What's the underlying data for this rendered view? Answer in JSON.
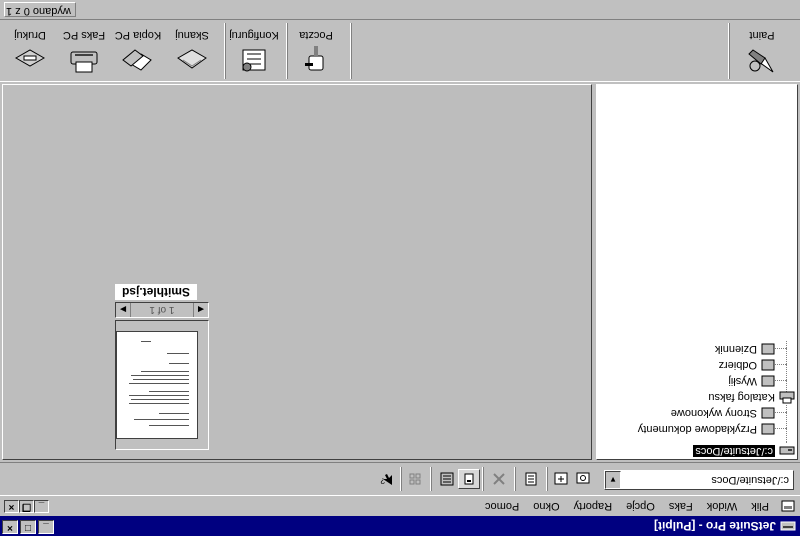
{
  "window": {
    "title": "JetSuite Pro - [Pulpit]",
    "controls": [
      "_",
      "□",
      "×"
    ]
  },
  "menu": {
    "items": [
      "Plik",
      "Widok",
      "Faks",
      "Opcje",
      "Raporty",
      "Okno",
      "Pomoc"
    ],
    "underline": [
      "P",
      "W",
      "F",
      "O",
      "R",
      "O",
      "P"
    ],
    "mdi_controls": [
      "_",
      "❐",
      "×"
    ]
  },
  "path_bar": {
    "value": "c:/Jetsuite/Docs",
    "arrow": "▼"
  },
  "tree": {
    "items": [
      {
        "label": "c:/Jetsuite/Docs",
        "level": 0,
        "selected": true,
        "icon": "drive-icon"
      },
      {
        "label": "Przykładowe dokumenty",
        "level": 1,
        "icon": "folder-icon"
      },
      {
        "label": "Strony wykonowe",
        "level": 1,
        "icon": "folder-icon"
      },
      {
        "label": "Katalog faksu",
        "level": 0,
        "icon": "fax-icon"
      },
      {
        "label": "Wysłij",
        "level": 1,
        "icon": "folder-icon"
      },
      {
        "label": "Odbierz",
        "level": 1,
        "icon": "folder-icon"
      },
      {
        "label": "Dziennik",
        "level": 1,
        "icon": "folder-icon"
      }
    ]
  },
  "thumbnail": {
    "name": "Smithlet.jsd",
    "pager": "1 of 1"
  },
  "toolbar": {
    "buttons": [
      {
        "label": "Drukuj",
        "icon": "printer-icon"
      },
      {
        "label": "Faks PC",
        "icon": "fax-icon"
      },
      {
        "label": "Kopia PC",
        "icon": "copy-icon"
      },
      {
        "label": "Skanuj",
        "icon": "scanner-icon"
      },
      {
        "label": "Konfiguruj",
        "icon": "configure-icon"
      },
      {
        "label": "Poczta",
        "icon": "mailbox-icon"
      },
      {
        "label": "Paint",
        "icon": "paint-icon"
      }
    ]
  },
  "status": {
    "text": "wydano 0 z 1"
  }
}
